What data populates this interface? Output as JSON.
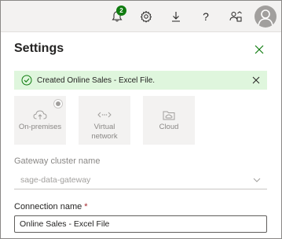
{
  "topbar": {
    "notification_count": "2",
    "icons": [
      "bell-icon",
      "gear-icon",
      "download-icon",
      "help-icon",
      "people-icon"
    ],
    "avatar_icon": "user-avatar-icon"
  },
  "panel": {
    "title": "Settings",
    "close_icon": "close-icon"
  },
  "banner": {
    "message": "Created Online Sales - Excel File.",
    "status": "success",
    "color": "#dff6dd"
  },
  "connection_types": [
    {
      "label": "On-premises",
      "icon": "cloud-upload-icon",
      "selected": true
    },
    {
      "label": "Virtual network",
      "icon": "virtual-network-icon",
      "selected": false
    },
    {
      "label": "Cloud",
      "icon": "cloud-folder-icon",
      "selected": false
    }
  ],
  "gateway": {
    "label": "Gateway cluster name",
    "value": "sage-data-gateway"
  },
  "connection_name": {
    "label": "Connection name",
    "required_marker": "*",
    "value": "Online Sales - Excel File"
  },
  "colors": {
    "accent_green": "#107c10",
    "required_red": "#a4262c"
  }
}
